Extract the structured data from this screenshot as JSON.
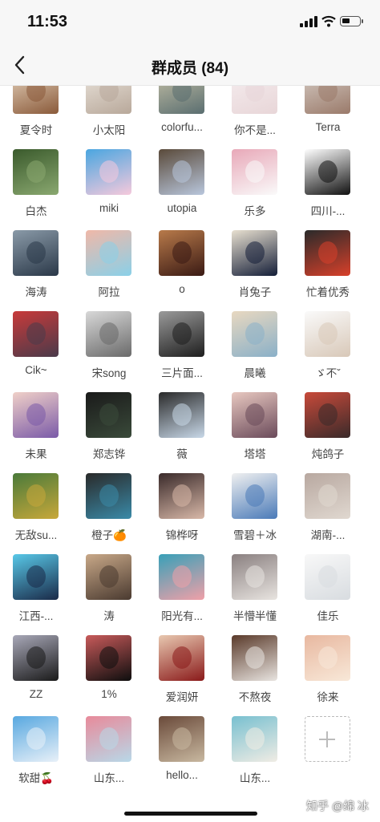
{
  "status": {
    "time": "11:53",
    "battery_level": 0.45
  },
  "header": {
    "title": "群成员 (84)"
  },
  "rows": [
    {
      "members": [
        {
          "name": "夏令时",
          "colors": [
            "#8a5a3a",
            "#e8d6c0"
          ]
        },
        {
          "name": "小太阳",
          "colors": [
            "#b8a89a",
            "#ece6de"
          ]
        },
        {
          "name": "colorfu...",
          "colors": [
            "#5a6e70",
            "#c9c3a8"
          ]
        },
        {
          "name": "你不是...",
          "colors": [
            "#e8d6d8",
            "#f6eef0"
          ]
        },
        {
          "name": "Terra",
          "colors": [
            "#9a7a6a",
            "#d8cfc8"
          ]
        }
      ]
    },
    {
      "members": [
        {
          "name": "白杰",
          "colors": [
            "#8aa870",
            "#3a5a2c"
          ]
        },
        {
          "name": "miki",
          "colors": [
            "#f6c9dc",
            "#4aa6e0"
          ]
        },
        {
          "name": "utopia",
          "colors": [
            "#b8c6dc",
            "#5a4a3a"
          ]
        },
        {
          "name": "乐多",
          "colors": [
            "#fafafa",
            "#e8a8b8"
          ]
        },
        {
          "name": "四川-...",
          "colors": [
            "#111111",
            "#ffffff"
          ]
        }
      ]
    },
    {
      "members": [
        {
          "name": "海涛",
          "colors": [
            "#2a3848",
            "#8a9aa8"
          ]
        },
        {
          "name": "阿拉",
          "colors": [
            "#8ad0e8",
            "#f0b8a8"
          ]
        },
        {
          "name": "o",
          "colors": [
            "#3a1a14",
            "#b87a4a"
          ]
        },
        {
          "name": "肖兔子",
          "colors": [
            "#141e38",
            "#e8e0d0"
          ]
        },
        {
          "name": "忙着优秀",
          "colors": [
            "#d8402a",
            "#2a2a2a"
          ]
        }
      ]
    },
    {
      "members": [
        {
          "name": "Cik~",
          "colors": [
            "#4a3a4a",
            "#c83a3a"
          ]
        },
        {
          "name": "宋song",
          "colors": [
            "#6a6a6a",
            "#d8d8d8"
          ]
        },
        {
          "name": "三片面...",
          "colors": [
            "#1e1e1e",
            "#9a9a9a"
          ]
        },
        {
          "name": "晨曦",
          "colors": [
            "#8ab0c8",
            "#e8d8c0"
          ]
        },
        {
          "name": "ゞ不ˇ",
          "colors": [
            "#d8c8b8",
            "#fafafa"
          ]
        }
      ]
    },
    {
      "members": [
        {
          "name": "未果",
          "colors": [
            "#7a5aa8",
            "#f0d0c8"
          ]
        },
        {
          "name": "郑志铧",
          "colors": [
            "#3a4a3a",
            "#1a1a1a"
          ]
        },
        {
          "name": "薇",
          "colors": [
            "#c8d8e8",
            "#2a2a2a"
          ]
        },
        {
          "name": "塔塔",
          "colors": [
            "#6a4a5a",
            "#e8c8c0"
          ]
        },
        {
          "name": "炖鸽子",
          "colors": [
            "#3a2a2a",
            "#c84a3a"
          ]
        }
      ]
    },
    {
      "members": [
        {
          "name": "无敌su...",
          "colors": [
            "#c8a83a",
            "#4a7a3a"
          ]
        },
        {
          "name": "橙子🍊",
          "colors": [
            "#3a8aa8",
            "#2a2a2a"
          ]
        },
        {
          "name": "锦桦呀",
          "colors": [
            "#d8b8a8",
            "#3a2a2a"
          ]
        },
        {
          "name": "雪碧＋冰",
          "colors": [
            "#4a7ab8",
            "#f0f0f0"
          ]
        },
        {
          "name": "湖南-...",
          "colors": [
            "#e0d8d0",
            "#b8a8a0"
          ]
        }
      ]
    },
    {
      "members": [
        {
          "name": "江西-...",
          "colors": [
            "#1a2a48",
            "#58c8e8"
          ]
        },
        {
          "name": "涛",
          "colors": [
            "#4a3a30",
            "#c8a888"
          ]
        },
        {
          "name": "阳光有...",
          "colors": [
            "#f0a0a8",
            "#38a0b8"
          ]
        },
        {
          "name": "半懵半懂",
          "colors": [
            "#e8e4e0",
            "#8a8080"
          ]
        },
        {
          "name": "佳乐",
          "colors": [
            "#d8dce0",
            "#f8f8f8"
          ]
        }
      ]
    },
    {
      "members": [
        {
          "name": "ZZ",
          "colors": [
            "#1a1a1a",
            "#a8a8b8"
          ]
        },
        {
          "name": "1%",
          "colors": [
            "#0e0e0e",
            "#c85a5a"
          ]
        },
        {
          "name": "爱润妍",
          "colors": [
            "#8a1a1a",
            "#e8c8b0"
          ]
        },
        {
          "name": "不熬夜",
          "colors": [
            "#e8e4e0",
            "#5a3a2a"
          ]
        },
        {
          "name": "徐来",
          "colors": [
            "#f8e8d8",
            "#e8b8a0"
          ]
        }
      ]
    },
    {
      "members": [
        {
          "name": "软甜🍒",
          "colors": [
            "#e8f0f8",
            "#58a8e0"
          ]
        },
        {
          "name": "山东...",
          "colors": [
            "#b8d8e8",
            "#e88a9a"
          ]
        },
        {
          "name": "hello...",
          "colors": [
            "#c8b8a0",
            "#6a4a3a"
          ]
        },
        {
          "name": "山东...",
          "colors": [
            "#f0ece4",
            "#78c0d0"
          ]
        }
      ]
    }
  ],
  "add_button": {
    "label": "add-member"
  },
  "watermark": "知乎 @绵 冰"
}
